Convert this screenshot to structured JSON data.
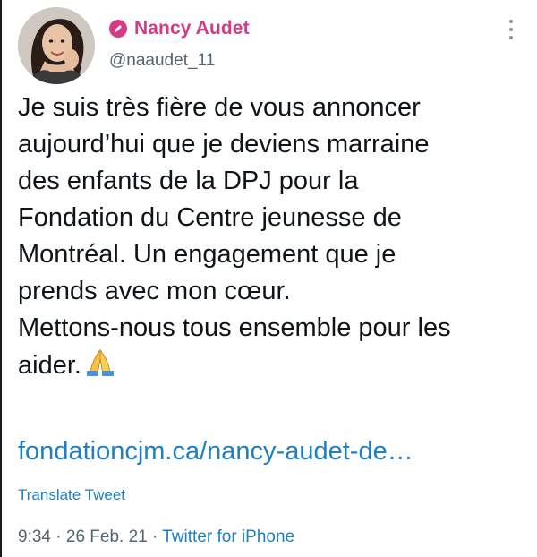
{
  "author": {
    "display_name": "Nancy Audet",
    "handle": "@naaudet_11",
    "badge_icon": "verified-badge-icon",
    "name_color": "#d63a84"
  },
  "tweet": {
    "lines": [
      "Je suis très fière de vous annoncer",
      "aujourd’hui que je deviens marraine",
      "des enfants de la DPJ pour la",
      "Fondation du Centre jeunesse de",
      "Montréal. Un engagement que je",
      "prends avec mon cœur.",
      "Mettons-nous tous ensemble pour les",
      "aider."
    ],
    "emoji": "folded-hands-icon",
    "link_text": "fondationcjm.ca/nancy-audet-de…",
    "translate_label": "Translate Tweet"
  },
  "meta": {
    "time": "9:34",
    "separator": " · ",
    "date": "26 Feb. 21",
    "source": "Twitter for iPhone"
  },
  "colors": {
    "link": "#1d7fc4",
    "secondary": "#536471"
  }
}
